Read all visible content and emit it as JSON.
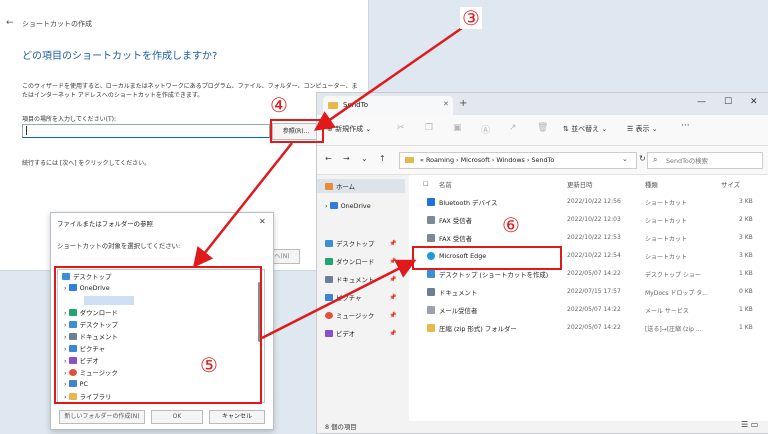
{
  "wizard": {
    "title": "ショートカットの作成",
    "heading": "どの項目のショートカットを作成しますか?",
    "description": "このウィザードを使用すると、ローカルまたはネットワークにあるプログラム、ファイル、フォルダー、コンピューター、またはインターネット アドレスへのショートカットを作成できます。",
    "location_label": "項目の場所を入力してください(T):",
    "location_value": "",
    "browse_label": "参照(R)...",
    "continue_text": "続行するには [次へ] をクリックしてください。",
    "next_label": "次へ(N)"
  },
  "explorer": {
    "tab_title": "SendTo",
    "toolbar": {
      "new_label": "新規作成",
      "sort_label": "並べ替え",
      "view_label": "表示",
      "more": "···"
    },
    "breadcrumb": "« Roaming › Microsoft › Windows › SendTo",
    "search_placeholder": "SendToの検索",
    "sidebar": [
      {
        "label": "ホーム"
      },
      {
        "label": "OneDrive"
      },
      {
        "label": "デスクトップ"
      },
      {
        "label": "ダウンロード"
      },
      {
        "label": "ドキュメント"
      },
      {
        "label": "ピクチャ"
      },
      {
        "label": "ミュージック"
      },
      {
        "label": "ビデオ"
      }
    ],
    "columns": {
      "name": "名前",
      "date": "更新日時",
      "type": "種類",
      "size": "サイズ"
    },
    "rows": [
      {
        "name": "Bluetooth デバイス",
        "date": "2022/10/22 12:56",
        "type": "ショートカット",
        "size": "3 KB"
      },
      {
        "name": "FAX 受信者",
        "date": "2022/10/22 12:03",
        "type": "ショートカット",
        "size": "2 KB"
      },
      {
        "name": "FAX 受信者",
        "date": "2022/10/22 12:53",
        "type": "ショートカット",
        "size": "3 KB"
      },
      {
        "name": "Microsoft Edge",
        "date": "2022/10/22 12:54",
        "type": "ショートカット",
        "size": "3 KB"
      },
      {
        "name": "デスクトップ (ショートカットを作成)",
        "date": "2022/05/07 14:22",
        "type": "デスクトップ ショー",
        "size": "1 KB"
      },
      {
        "name": "ドキュメント",
        "date": "2022/07/15 17:57",
        "type": "MyDocs ドロップ タ...",
        "size": "0 KB"
      },
      {
        "name": "メール受信者",
        "date": "2022/05/07 14:22",
        "type": "メール サービス",
        "size": "1 KB"
      },
      {
        "name": "圧縮 (zip 形式) フォルダー",
        "date": "2022/05/07 14:22",
        "type": "[送る]→[圧縮 (zip ...",
        "size": "1 KB"
      }
    ],
    "status": "8 個の項目"
  },
  "browse": {
    "title": "ファイルまたはフォルダーの参照",
    "prompt": "ショートカットの対象を選択してください:",
    "tree": [
      {
        "label": "デスクトップ"
      },
      {
        "label": "OneDrive"
      },
      {
        "label": ""
      },
      {
        "label": "ダウンロード"
      },
      {
        "label": "デスクトップ"
      },
      {
        "label": "ドキュメント"
      },
      {
        "label": "ピクチャ"
      },
      {
        "label": "ビデオ"
      },
      {
        "label": "ミュージック"
      },
      {
        "label": "PC"
      },
      {
        "label": "ライブラリ"
      }
    ],
    "new_folder_label": "新しいフォルダーの作成(N)",
    "ok_label": "OK",
    "cancel_label": "キャンセル"
  },
  "annotations": {
    "n3": "③",
    "n4": "④",
    "n5": "⑤",
    "n6": "⑥",
    "color": "#e0191b"
  }
}
